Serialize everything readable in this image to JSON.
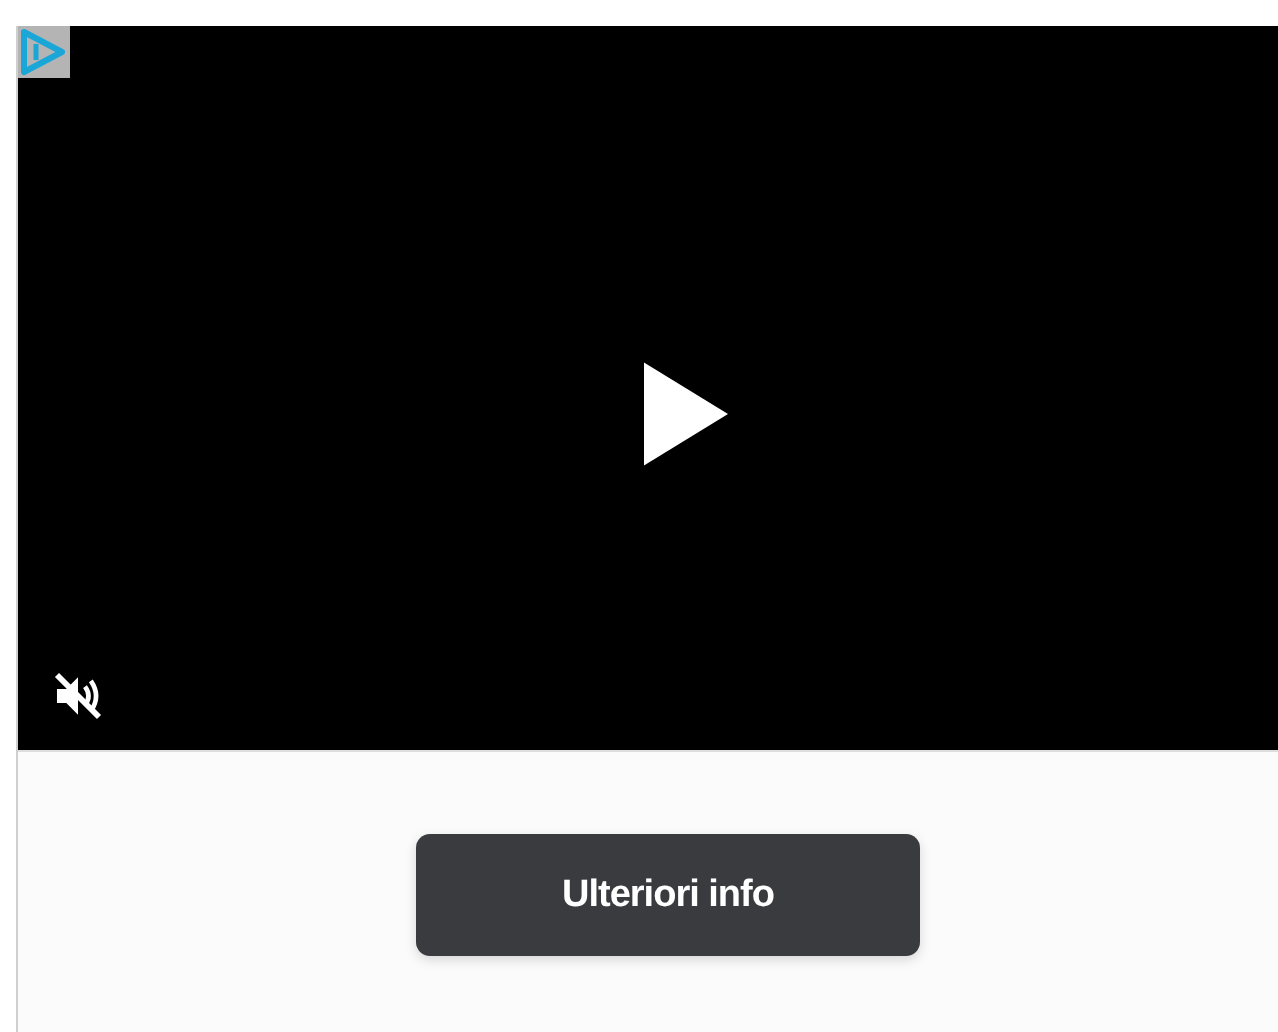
{
  "video": {
    "muted": true
  },
  "cta_button": {
    "label": "Ulteriori info"
  }
}
